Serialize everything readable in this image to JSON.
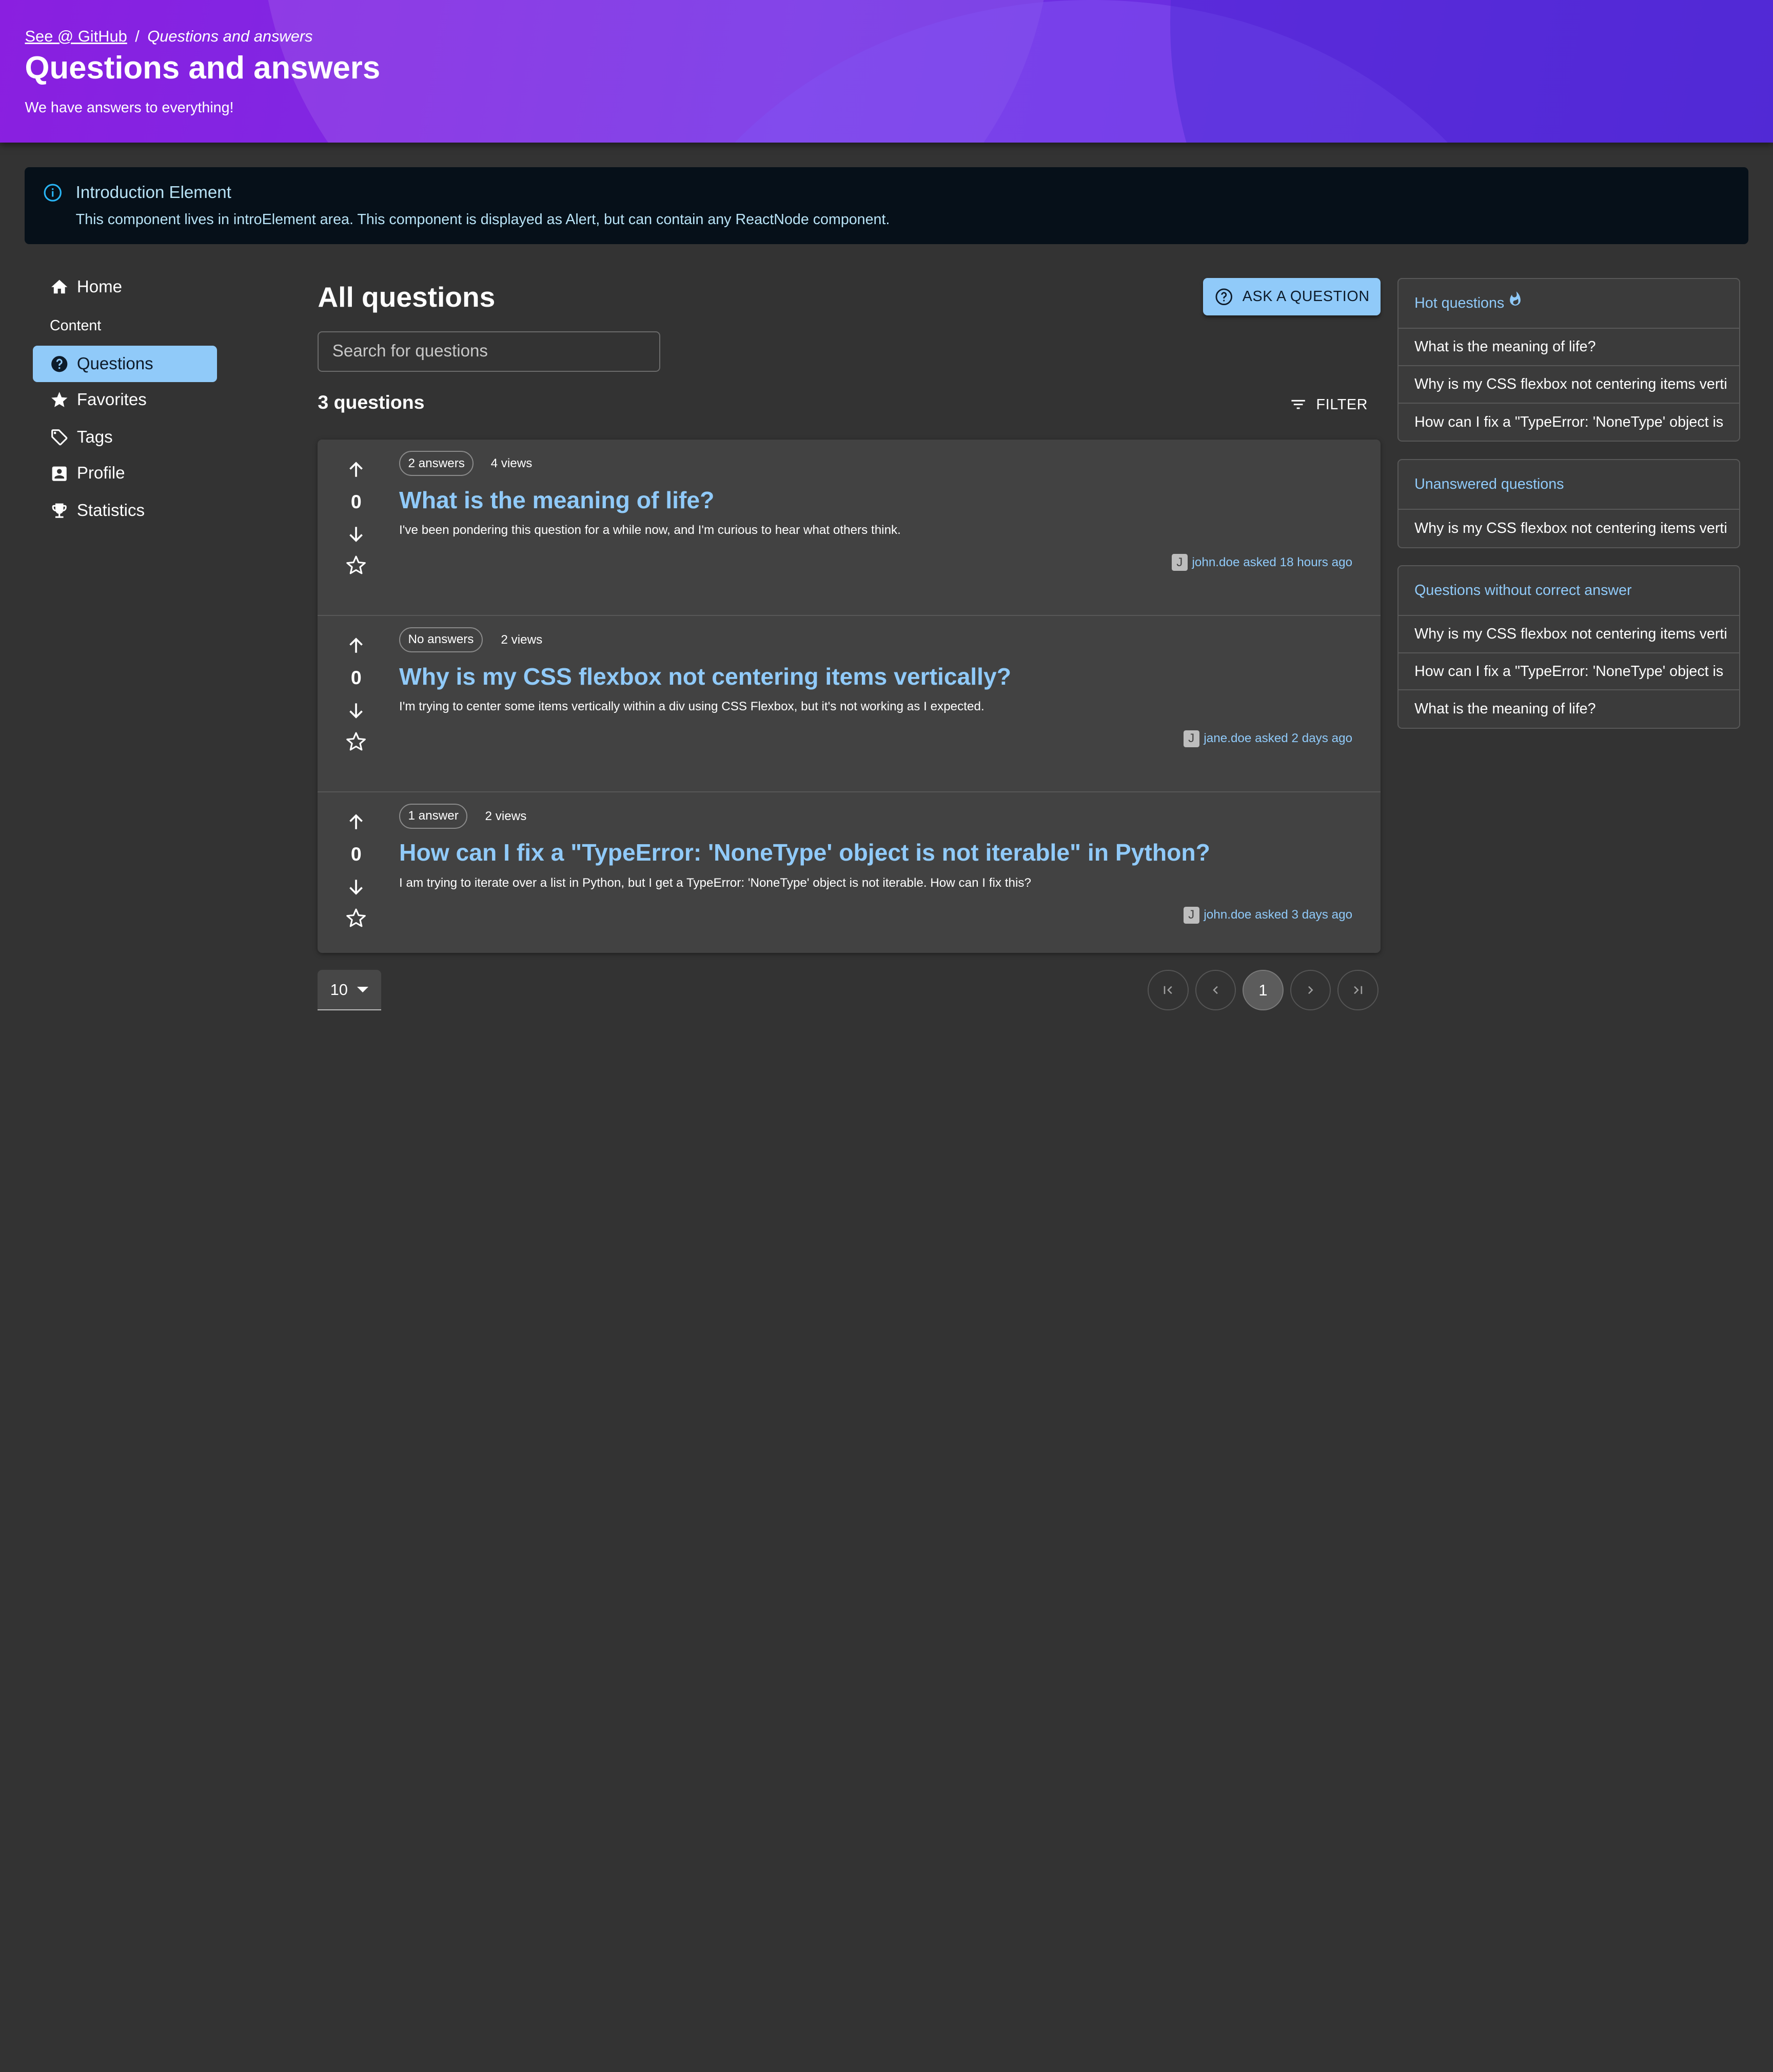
{
  "header": {
    "breadcrumb_link": "See @ GitHub",
    "breadcrumb_separator": "/",
    "breadcrumb_current": "Questions and answers",
    "title": "Questions and answers",
    "subtitle": "We have answers to everything!",
    "gradient_colors": [
      "#8a1fe0",
      "#7530e6",
      "#5a2ad8"
    ]
  },
  "alert": {
    "icon": "info-icon",
    "title": "Introduction Element",
    "text": "This component lives in introElement area. This component is displayed as Alert, but can contain any ReactNode component."
  },
  "sidebar": {
    "items": [
      {
        "label": "Home",
        "icon": "home-icon"
      },
      {
        "label": "Questions",
        "icon": "help-circle-icon",
        "active": true
      },
      {
        "label": "Favorites",
        "icon": "star-icon"
      },
      {
        "label": "Tags",
        "icon": "tag-icon"
      },
      {
        "label": "Profile",
        "icon": "account-box-icon"
      },
      {
        "label": "Statistics",
        "icon": "trophy-icon"
      }
    ],
    "section_label": "Content"
  },
  "main": {
    "title": "All questions",
    "ask_button": "ASK A QUESTION",
    "search_placeholder": "Search for questions",
    "count": "3 questions",
    "filter_button": "FILTER",
    "questions": [
      {
        "answers": "2 answers",
        "views": "4 views",
        "score": "0",
        "title": "What is the meaning of life?",
        "excerpt": "I've been pondering this question for a while now, and I'm curious to hear what others think.",
        "avatar_letter": "J",
        "meta": "john.doe asked 18 hours ago"
      },
      {
        "answers": "No answers",
        "views": "2 views",
        "score": "0",
        "title": "Why is my CSS flexbox not centering items vertically?",
        "excerpt": "I'm trying to center some items vertically within a div using CSS Flexbox, but it's not working as I expected.",
        "avatar_letter": "J",
        "meta": "jane.doe asked 2 days ago"
      },
      {
        "answers": "1 answer",
        "views": "2 views",
        "score": "0",
        "title": "How can I fix a \"TypeError: 'NoneType' object is not iterable\" in Python?",
        "excerpt": "I am trying to iterate over a list in Python, but I get a TypeError: 'NoneType' object is not iterable. How can I fix this?",
        "avatar_letter": "J",
        "meta": "john.doe asked 3 days ago"
      }
    ],
    "pagination": {
      "page_size": "10",
      "current_page": "1"
    }
  },
  "right": {
    "hot": {
      "title": "Hot questions",
      "items": [
        "What is the meaning of life?",
        "Why is my CSS flexbox not centering items verti",
        "How can I fix a \"TypeError: 'NoneType' object is"
      ]
    },
    "unanswered": {
      "title": "Unanswered questions",
      "items": [
        "Why is my CSS flexbox not centering items verti"
      ]
    },
    "no_correct": {
      "title": "Questions without correct answer",
      "items": [
        "Why is my CSS flexbox not centering items verti",
        "How can I fix a \"TypeError: 'NoneType' object is",
        "What is the meaning of life?"
      ]
    }
  },
  "colors": {
    "background": "#333333",
    "surface": "#424242",
    "accent": "#90caf9",
    "alert_bg": "#061019"
  }
}
